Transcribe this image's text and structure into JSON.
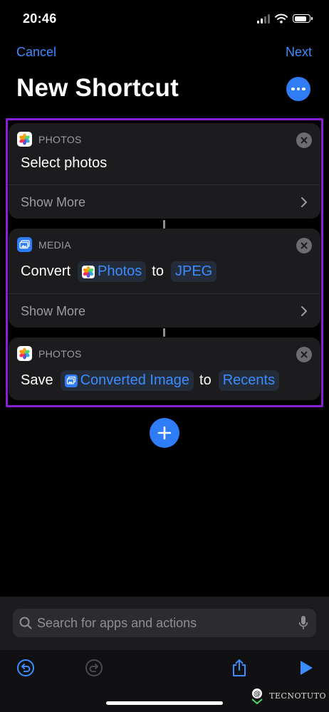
{
  "status_bar": {
    "time": "20:46"
  },
  "nav": {
    "cancel_label": "Cancel",
    "next_label": "Next",
    "title": "New Shortcut"
  },
  "actions": [
    {
      "app": "PHOTOS",
      "text": "Select photos",
      "show_more": "Show More"
    },
    {
      "app": "MEDIA",
      "verb": "Convert",
      "token1": "Photos",
      "connector": "to",
      "token2": "JPEG",
      "show_more": "Show More"
    },
    {
      "app": "PHOTOS",
      "verb": "Save",
      "token1": "Converted Image",
      "connector": "to",
      "token2": "Recents"
    }
  ],
  "search": {
    "placeholder": "Search for apps and actions"
  },
  "watermark": {
    "text": "TECNOTUTO"
  },
  "colors": {
    "accent": "#3a8cff",
    "button_blue": "#2e7cf6",
    "highlight": "#8a1ed6",
    "card_bg": "#1c1c1e"
  },
  "icons": [
    "signal-icon",
    "wifi-icon",
    "battery-icon",
    "more-icon",
    "photos-app-icon",
    "media-app-icon",
    "close-icon",
    "chevron-right-icon",
    "plus-icon",
    "search-icon",
    "microphone-icon",
    "undo-icon",
    "redo-icon",
    "share-icon",
    "play-icon"
  ]
}
